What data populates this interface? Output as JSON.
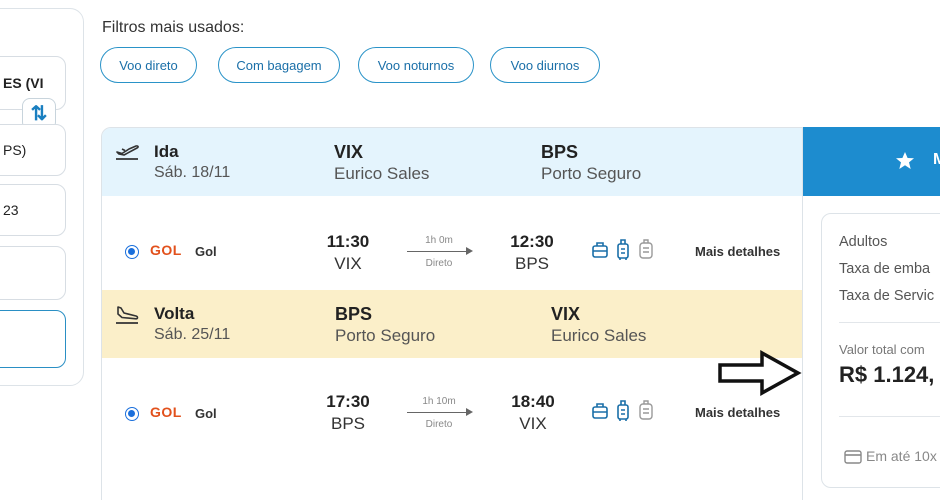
{
  "search_panel": {
    "origin_value": "ES (VI",
    "destination_value": "PS)",
    "date_value": "23",
    "swap_icon": "swap-vertical-icon"
  },
  "filters": {
    "title": "Filtros mais usados:",
    "chips": [
      "Voo direto",
      "Com bagagem",
      "Voo noturnos",
      "Voo diurnos"
    ]
  },
  "outbound": {
    "label": "Ida",
    "date": "Sáb. 18/11",
    "origin_code": "VIX",
    "origin_city": "Eurico Sales",
    "dest_code": "BPS",
    "dest_city": "Porto Seguro",
    "icon": "plane-takeoff-icon",
    "flight": {
      "airline_logo": "GOL",
      "airline": "Gol",
      "depart_time": "11:30",
      "depart_code": "VIX",
      "duration": "1h 0m",
      "stops": "Direto",
      "arrive_time": "12:30",
      "arrive_code": "BPS",
      "details": "Mais detalhes"
    }
  },
  "return": {
    "label": "Volta",
    "date": "Sáb. 25/11",
    "origin_code": "BPS",
    "origin_city": "Porto Seguro",
    "dest_code": "VIX",
    "dest_city": "Eurico Sales",
    "icon": "plane-landing-icon",
    "flight": {
      "airline_logo": "GOL",
      "airline": "Gol",
      "depart_time": "17:30",
      "depart_code": "BPS",
      "duration": "1h 10m",
      "stops": "Direto",
      "arrive_time": "18:40",
      "arrive_code": "VIX",
      "details": "Mais detalhes"
    }
  },
  "summary": {
    "header_text": "M",
    "lines": [
      "Adultos",
      "Taxa de emba",
      "Taxa de Servic"
    ],
    "total_label": "Valor total com",
    "total_value": "R$ 1.124,",
    "installments": "Em até 10x"
  },
  "colors": {
    "accent": "#1d8ccf",
    "outbound_bg": "#e4f4fd",
    "return_bg": "#fbefc9",
    "airline_brand": "#e2511c"
  }
}
